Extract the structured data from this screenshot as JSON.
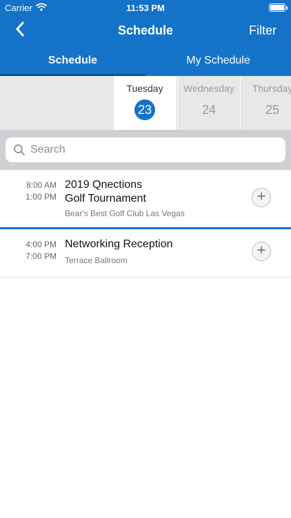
{
  "status_bar": {
    "carrier": "Carrier",
    "time": "11:53 PM"
  },
  "nav": {
    "title": "Schedule",
    "filter_label": "Filter",
    "back_icon": "chevron-left-icon"
  },
  "tabs": [
    {
      "label": "Schedule",
      "active": true
    },
    {
      "label": "My Schedule",
      "active": false
    }
  ],
  "days": [
    {
      "name": "Tuesday",
      "number": "23",
      "selected": true
    },
    {
      "name": "Wednesday",
      "number": "24",
      "selected": false
    },
    {
      "name": "Thursday",
      "number": "25",
      "selected": false
    }
  ],
  "search": {
    "placeholder": "Search",
    "value": ""
  },
  "sessions": [
    {
      "start": "8:00 AM",
      "end": "1:00 PM",
      "title_line1": "2019 Qnections",
      "title_line2": "Golf Tournament",
      "location": "Bear's Best Golf Club Las Vegas"
    },
    {
      "start": "4:00 PM",
      "end": "7:00 PM",
      "title_line1": "Networking Reception",
      "location": "Terrace Ballroom"
    }
  ],
  "colors": {
    "brand": "#1473c9",
    "tab_indicator": "#0b4f95",
    "day_strip_bg": "#e8e8e8",
    "search_bg": "#cfcfd4"
  }
}
